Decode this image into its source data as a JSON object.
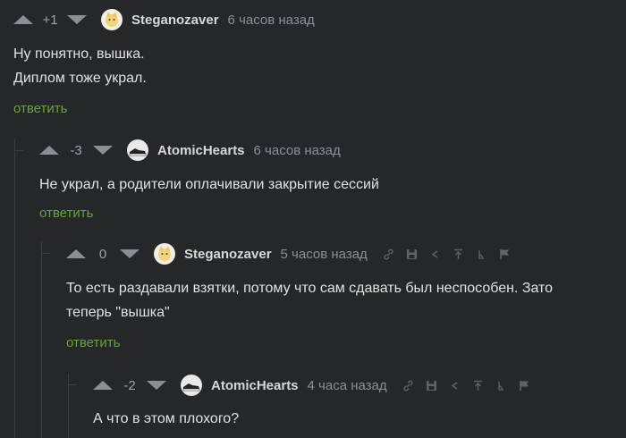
{
  "comments": [
    {
      "rating": "+1",
      "username": "Steganozaver",
      "time": "6 часов назад",
      "lines": [
        "Ну понятно, вышка.",
        "Диплом тоже украл."
      ],
      "reply_label": "ответить",
      "avatar_icon": "cat-avatar-icon"
    },
    {
      "rating": "-3",
      "username": "AtomicHearts",
      "time": "6 часов назад",
      "lines": [
        "Не украл, а родители оплачивали закрытие сессий"
      ],
      "reply_label": "ответить",
      "avatar_icon": "sneaker-avatar-icon"
    },
    {
      "rating": "0",
      "username": "Steganozaver",
      "time": "5 часов назад",
      "lines": [
        "То есть раздавали взятки, потому что сам сдавать был неспособен. Зато",
        "теперь \"вышка\""
      ],
      "reply_label": "ответить",
      "avatar_icon": "cat-avatar-icon"
    },
    {
      "rating": "-2",
      "username": "AtomicHearts",
      "time": "4 часа назад",
      "lines": [
        "А что в этом плохого?"
      ],
      "avatar_icon": "sneaker-avatar-icon"
    }
  ],
  "colors": {
    "background": "#25272b",
    "reply_link": "#66a53a",
    "arrow": "#8b8e93",
    "username": "#d6d8db"
  },
  "icons": [
    "link-icon",
    "save-icon",
    "share-icon",
    "to-parent-icon",
    "collapse-icon",
    "report-flag-icon"
  ]
}
